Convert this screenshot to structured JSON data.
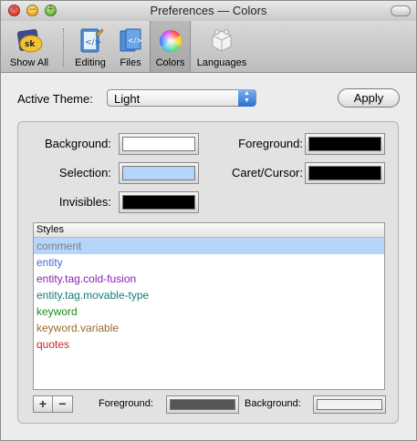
{
  "window": {
    "title": "Preferences — Colors"
  },
  "toolbar": {
    "items": [
      {
        "label": "Show All",
        "icon": "show-all-icon"
      },
      {
        "label": "Editing",
        "icon": "editing-icon"
      },
      {
        "label": "Files",
        "icon": "files-icon"
      },
      {
        "label": "Colors",
        "icon": "color-wheel-icon",
        "selected": true
      },
      {
        "label": "Languages",
        "icon": "languages-icon"
      }
    ]
  },
  "theme": {
    "label": "Active Theme:",
    "value": "Light",
    "apply_label": "Apply"
  },
  "colors": {
    "background": {
      "label": "Background:",
      "color": "#ffffff"
    },
    "foreground": {
      "label": "Foreground:",
      "color": "#000000"
    },
    "selection": {
      "label": "Selection:",
      "color": "#b5d5fb"
    },
    "caret": {
      "label": "Caret/Cursor:",
      "color": "#000000"
    },
    "invisibles": {
      "label": "Invisibles:",
      "color": "#000000"
    }
  },
  "styles": {
    "header": "Styles",
    "items": [
      {
        "name": "comment",
        "color": "#808080",
        "selected": true
      },
      {
        "name": "entity",
        "color": "#3a6fd8"
      },
      {
        "name": "entity.tag.cold-fusion",
        "color": "#8a1fb4"
      },
      {
        "name": "entity.tag.movable-type",
        "color": "#167a7a"
      },
      {
        "name": "keyword",
        "color": "#1b8a1b"
      },
      {
        "name": "keyword.variable",
        "color": "#9a6a2a"
      },
      {
        "name": "quotes",
        "color": "#c02828"
      }
    ]
  },
  "style_controls": {
    "add_label": "+",
    "remove_label": "−",
    "foreground_label": "Foreground:",
    "foreground_color": "#555555",
    "background_label": "Background:",
    "background_color": "#f2f2f2"
  }
}
